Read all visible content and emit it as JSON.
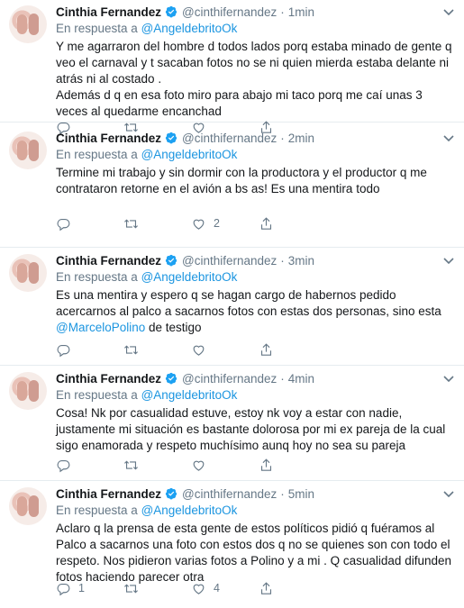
{
  "tweets": [
    {
      "name": "Cinthia Fernandez",
      "handle": "@cinthifernandez",
      "time": "1min",
      "reply_prefix": "En respuesta a",
      "reply_to": "@AngeldebritoOk",
      "paragraphs": [
        "Y me agarraron del hombre d todos lados porq estaba minado de gente q veo el carnaval y t sacaban fotos no se ni quien mierda estaba delante ni atrás ni al costado .",
        "Además d q en esa foto miro para abajo mi taco porq me caí unas 3 veces al quedarme encanchad"
      ],
      "reply_count": "",
      "retweet_count": "",
      "like_count": ""
    },
    {
      "name": "Cinthia Fernandez",
      "handle": "@cinthifernandez",
      "time": "2min",
      "reply_prefix": "En respuesta a",
      "reply_to": "@AngeldebritoOk",
      "paragraphs": [
        "Termine mi trabajo y sin dormir con la productora y el productor q me contrataron retorne en el avión a bs as! Es una mentira todo"
      ],
      "reply_count": "",
      "retweet_count": "",
      "like_count": "2"
    },
    {
      "name": "Cinthia Fernandez",
      "handle": "@cinthifernandez",
      "time": "3min",
      "reply_prefix": "En respuesta a",
      "reply_to": "@AngeldebritoOk",
      "text_before_mention": "Es una mentira y espero q se hagan cargo de habernos pedido acercarnos al palco a sacarnos fotos con estas dos personas, sino esta ",
      "inline_mention": "@MarceloPolino",
      "text_after_mention": " de testigo",
      "reply_count": "",
      "retweet_count": "",
      "like_count": ""
    },
    {
      "name": "Cinthia Fernandez",
      "handle": "@cinthifernandez",
      "time": "4min",
      "reply_prefix": "En respuesta a",
      "reply_to": "@AngeldebritoOk",
      "paragraphs": [
        "Cosa! Nk por casualidad estuve, estoy nk voy a estar con nadie, justamente mi situación es bastante dolorosa por mi ex pareja de la cual sigo enamorada  y respeto muchísimo aunq hoy no sea su pareja"
      ],
      "reply_count": "",
      "retweet_count": "",
      "like_count": ""
    },
    {
      "name": "Cinthia Fernandez",
      "handle": "@cinthifernandez",
      "time": "5min",
      "reply_prefix": "En respuesta a",
      "reply_to": "@AngeldebritoOk",
      "paragraphs": [
        "Aclaro q la prensa de esta gente de estos políticos pidió q fuéramos al Palco a sacarnos una foto con estos dos q no se quienes son con todo el respeto. Nos pidieron varias fotos a Polino y a mi . Q casualidad difunden fotos haciendo parecer otra"
      ],
      "reply_count": "1",
      "retweet_count": "",
      "like_count": "4"
    }
  ],
  "icons": {
    "verified": "verified-badge-icon",
    "chevron": "chevron-down-icon",
    "reply": "reply-icon",
    "retweet": "retweet-icon",
    "like": "like-icon",
    "share": "share-icon"
  },
  "colors": {
    "link": "#1b95e0",
    "muted": "#657786",
    "text": "#14171a",
    "divider": "#e6ecf0"
  }
}
